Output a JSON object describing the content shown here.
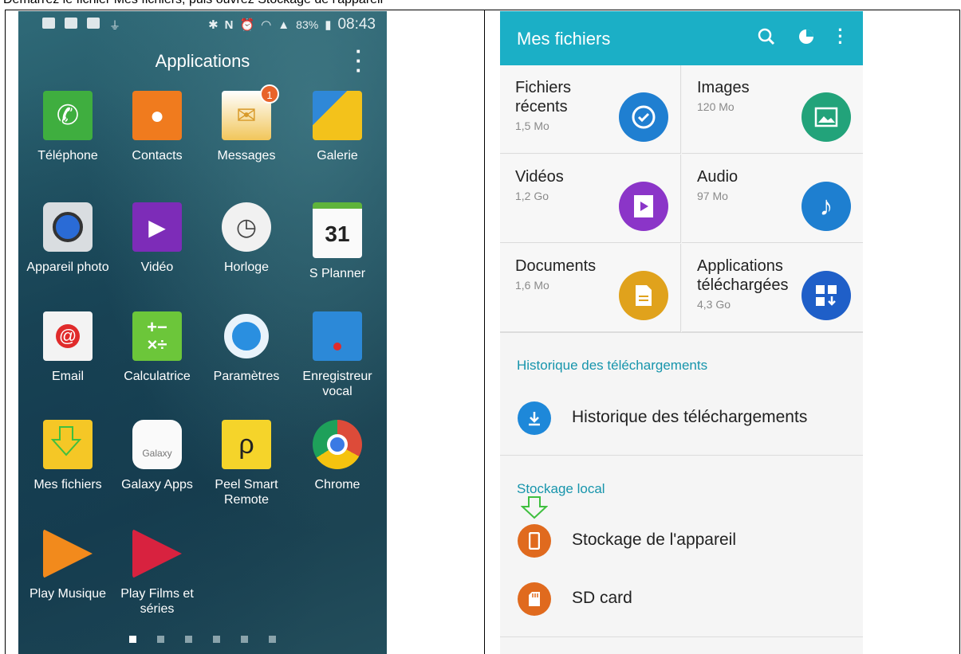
{
  "caption": "Démarrez le fichier Mes fichiers, puis ouvrez Stockage de l'appareil",
  "left_phone": {
    "status": {
      "battery": "83%",
      "time": "08:43"
    },
    "title": "Applications",
    "apps": [
      {
        "label": "Téléphone",
        "icon": "phone-icon"
      },
      {
        "label": "Contacts",
        "icon": "contacts-icon"
      },
      {
        "label": "Messages",
        "icon": "messages-icon",
        "badge": "1"
      },
      {
        "label": "Galerie",
        "icon": "gallery-icon"
      },
      {
        "label": "Appareil photo",
        "icon": "camera-icon"
      },
      {
        "label": "Vidéo",
        "icon": "video-icon"
      },
      {
        "label": "Horloge",
        "icon": "clock-icon"
      },
      {
        "label": "S Planner",
        "icon": "calendar-icon",
        "day": "31"
      },
      {
        "label": "Email",
        "icon": "email-icon"
      },
      {
        "label": "Calculatrice",
        "icon": "calculator-icon"
      },
      {
        "label": "Paramètres",
        "icon": "settings-icon"
      },
      {
        "label": "Enregistreur vocal",
        "icon": "voice-recorder-icon"
      },
      {
        "label": "Mes fichiers",
        "icon": "my-files-icon"
      },
      {
        "label": "Galaxy Apps",
        "icon": "galaxy-apps-icon",
        "sub": "Galaxy"
      },
      {
        "label": "Peel Smart Remote",
        "icon": "peel-remote-icon"
      },
      {
        "label": "Chrome",
        "icon": "chrome-icon"
      },
      {
        "label": "Play Musique",
        "icon": "play-music-icon"
      },
      {
        "label": "Play Films et séries",
        "icon": "play-movies-icon"
      }
    ]
  },
  "right_phone": {
    "title": "Mes fichiers",
    "tiles": [
      {
        "name": "Fichiers récents",
        "size": "1,5 Mo",
        "color": "#1f7fd1",
        "icon": "recent-files-icon"
      },
      {
        "name": "Images",
        "size": "120 Mo",
        "color": "#22a37a",
        "icon": "images-icon"
      },
      {
        "name": "Vidéos",
        "size": "1,2 Go",
        "color": "#8b35c8",
        "icon": "videos-icon"
      },
      {
        "name": "Audio",
        "size": "97 Mo",
        "color": "#1e7fd0",
        "icon": "audio-icon"
      },
      {
        "name": "Documents",
        "size": "1,6 Mo",
        "color": "#e0a21c",
        "icon": "documents-icon"
      },
      {
        "name": "Applications téléchargées",
        "size": "4,3 Go",
        "color": "#1f5fc8",
        "icon": "downloaded-apps-icon"
      }
    ],
    "history_section": "Historique des téléchargements",
    "history_item": "Historique des téléchargements",
    "storage_section": "Stockage local",
    "storage_items": [
      {
        "label": "Stockage de l'appareil",
        "color": "#e06a1e",
        "icon": "device-storage-icon"
      },
      {
        "label": "SD card",
        "color": "#e06a1e",
        "icon": "sd-card-icon"
      }
    ]
  }
}
